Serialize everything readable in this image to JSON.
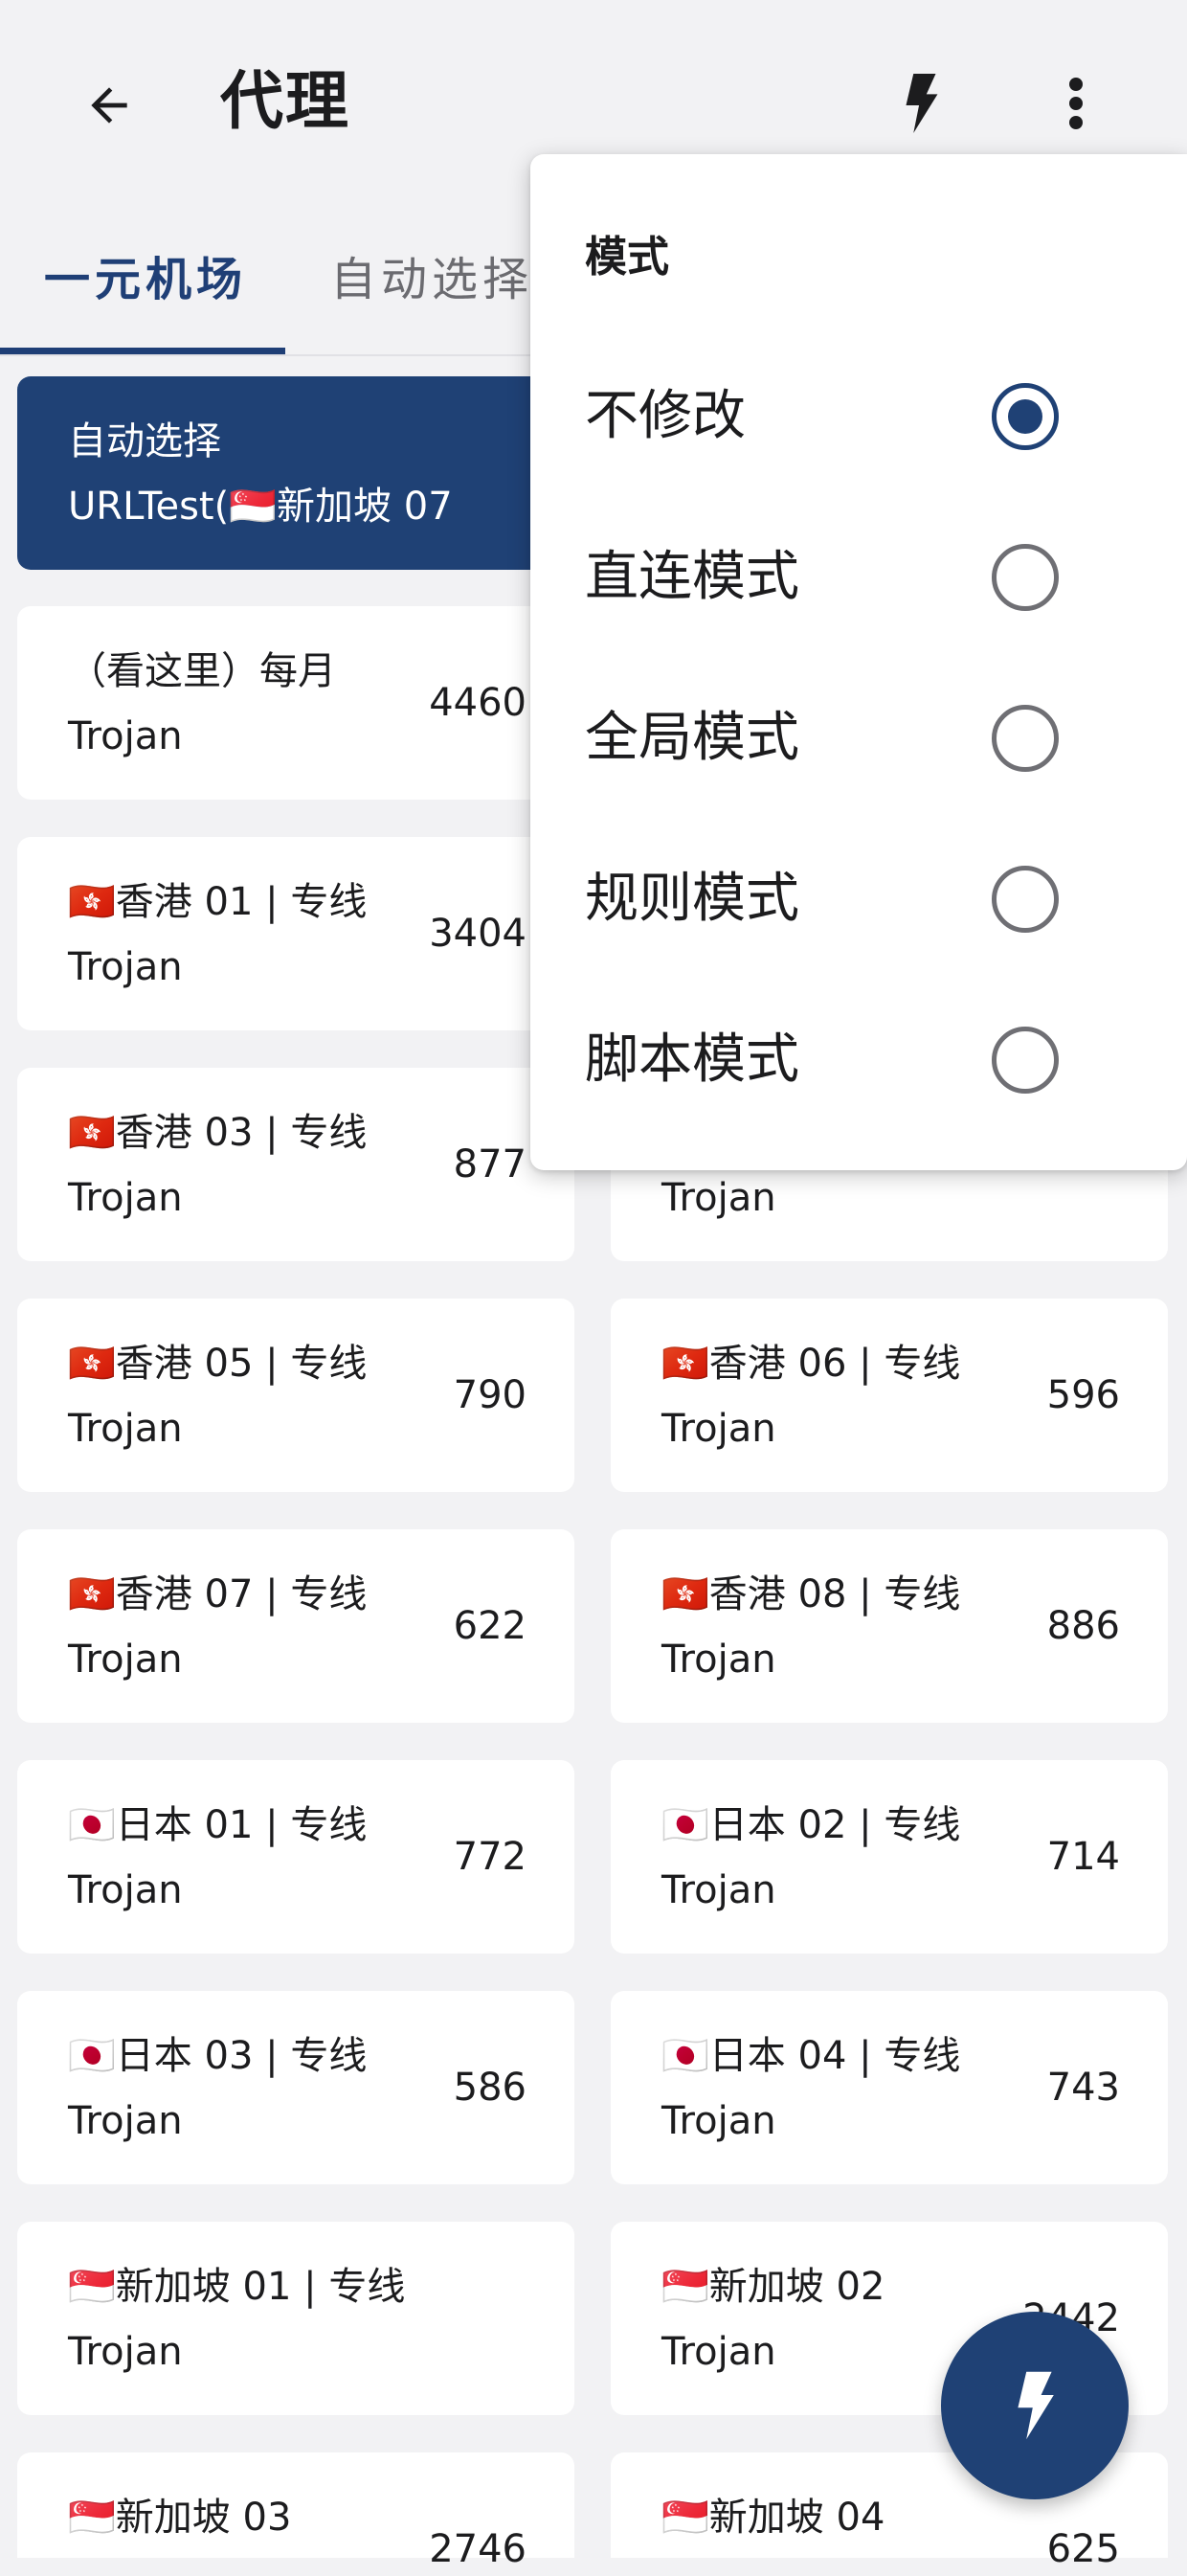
{
  "appbar": {
    "title": "代理",
    "back_icon": "arrow-left-icon",
    "test_icon": "lightning-bolt-icon",
    "more_icon": "more-vertical-icon"
  },
  "tabs": [
    {
      "label": "一元机场",
      "active": true
    },
    {
      "label": "自动选择",
      "active": false
    }
  ],
  "selected_group": {
    "name": "自动选择",
    "detail": "URLTest(🇸🇬新加坡 07"
  },
  "proxies": [
    {
      "name": "（看这里）每月",
      "type": "Trojan",
      "delay": "4460"
    },
    {
      "name": "",
      "type": "",
      "delay": ""
    },
    {
      "name": "🇭🇰香港 01 | 专线",
      "type": "Trojan",
      "delay": "3404"
    },
    {
      "name": "",
      "type": "",
      "delay": ""
    },
    {
      "name": "🇭🇰香港 03 | 专线",
      "type": "Trojan",
      "delay": "877"
    },
    {
      "name": "",
      "type": "Trojan",
      "delay": ""
    },
    {
      "name": "🇭🇰香港 05 | 专线",
      "type": "Trojan",
      "delay": "790"
    },
    {
      "name": "🇭🇰香港 06 | 专线",
      "type": "Trojan",
      "delay": "596"
    },
    {
      "name": "🇭🇰香港 07 | 专线",
      "type": "Trojan",
      "delay": "622"
    },
    {
      "name": "🇭🇰香港 08 | 专线",
      "type": "Trojan",
      "delay": "886"
    },
    {
      "name": "🇯🇵日本 01 | 专线",
      "type": "Trojan",
      "delay": "772"
    },
    {
      "name": "🇯🇵日本 02 | 专线",
      "type": "Trojan",
      "delay": "714"
    },
    {
      "name": "🇯🇵日本 03 | 专线",
      "type": "Trojan",
      "delay": "586"
    },
    {
      "name": "🇯🇵日本 04 | 专线",
      "type": "Trojan",
      "delay": "743"
    },
    {
      "name": "🇸🇬新加坡 01 | 专线",
      "type": "Trojan",
      "delay": ""
    },
    {
      "name": "🇸🇬新加坡 02",
      "type": "Trojan",
      "delay": "2442"
    },
    {
      "name": "🇸🇬新加坡 03",
      "type": "",
      "delay": "2746"
    },
    {
      "name": "🇸🇬新加坡 04",
      "type": "",
      "delay": "625"
    }
  ],
  "mode_menu": {
    "header": "模式",
    "options": [
      {
        "label": "不修改",
        "checked": true
      },
      {
        "label": "直连模式",
        "checked": false
      },
      {
        "label": "全局模式",
        "checked": false
      },
      {
        "label": "规则模式",
        "checked": false
      },
      {
        "label": "脚本模式",
        "checked": false
      }
    ]
  },
  "fab": {
    "icon": "lightning-bolt-icon"
  },
  "colors": {
    "primary": "#1f4175",
    "background": "#f2f2f4",
    "card": "#ffffff"
  }
}
